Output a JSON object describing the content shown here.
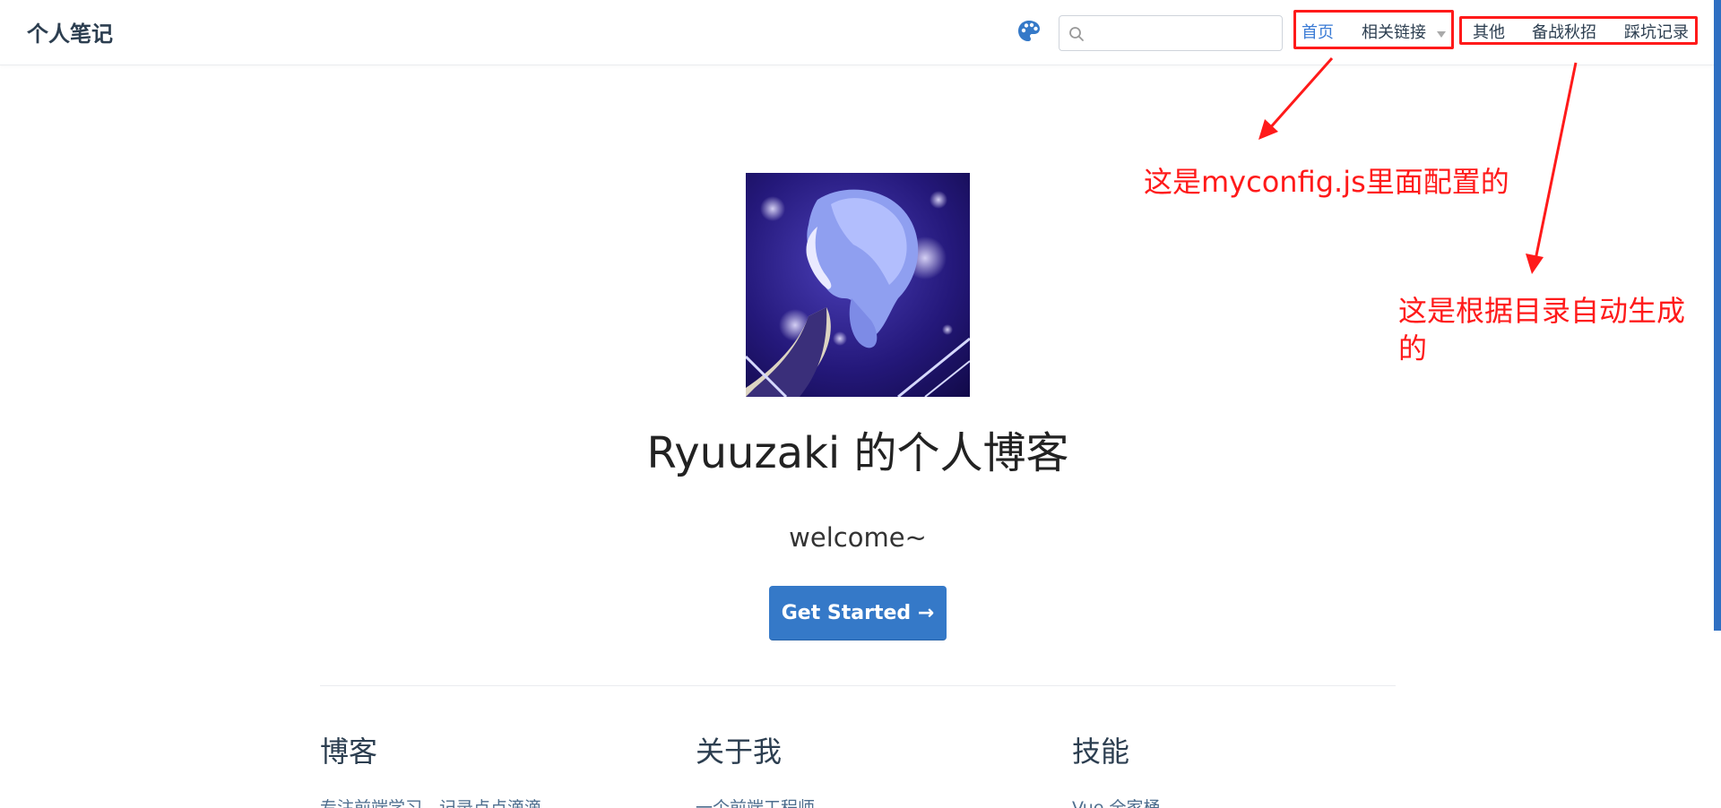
{
  "navbar": {
    "site_name": "个人笔记",
    "search": {
      "value": "",
      "placeholder": ""
    },
    "links": {
      "home": "首页",
      "related": "相关链接",
      "other": "其他",
      "prep": "备战秋招",
      "pitfalls": "踩坑记录"
    }
  },
  "hero": {
    "title": "Ryuuzaki 的个人博客",
    "description": "welcome~",
    "action": "Get Started →"
  },
  "features": [
    {
      "title": "博客",
      "details": "专注前端学习，记录点点滴滴"
    },
    {
      "title": "关于我",
      "details": "一个前端工程师"
    },
    {
      "title": "技能",
      "details": "Vue 全家桶"
    }
  ],
  "annotations": {
    "config_note": "这是myconfig.js里面配置的",
    "auto_note_line1": "这是根据目录自动生成",
    "auto_note_line2": "的"
  },
  "icons": {
    "palette": "palette-icon",
    "search": "search-icon",
    "dropdown": "chevron-down-icon"
  },
  "colors": {
    "accent_blue": "#3579c8",
    "annotation_red": "#ff1a1a",
    "link_active": "#3a7bd5"
  }
}
